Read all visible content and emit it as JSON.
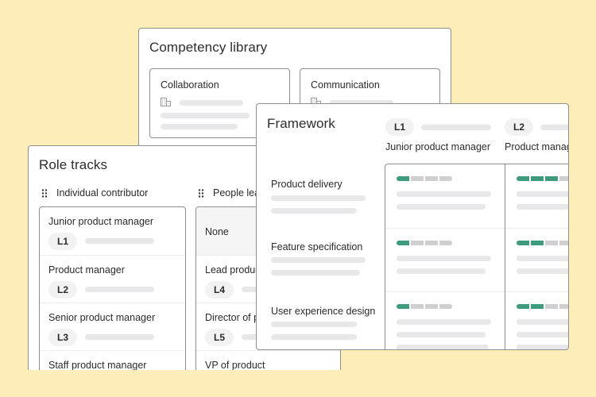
{
  "colors": {
    "background": "#fdedb8",
    "accent_green": "#3e9b7d",
    "rating_off": "#cfcfd1",
    "border": "#8f8f8f"
  },
  "competency_library": {
    "title": "Competency library",
    "cards": [
      {
        "label": "Collaboration",
        "icon": "building-icon"
      },
      {
        "label": "Communication",
        "icon": "building-icon"
      }
    ]
  },
  "role_tracks": {
    "title": "Role tracks",
    "columns": [
      {
        "heading": "Individual contributor",
        "icon": "drag-handle-icon",
        "items": [
          {
            "title": "Junior product manager",
            "level": "L1"
          },
          {
            "title": "Product manager",
            "level": "L2"
          },
          {
            "title": "Senior product manager",
            "level": "L3"
          },
          {
            "title": "Staff product manager",
            "level": ""
          }
        ]
      },
      {
        "heading": "People leader",
        "icon": "drag-handle-icon",
        "items": [
          {
            "title": "None",
            "level": ""
          },
          {
            "title": "Lead product manager",
            "level": "L4"
          },
          {
            "title": "Director of product",
            "level": "L5"
          },
          {
            "title": "VP of product",
            "level": ""
          }
        ]
      }
    ]
  },
  "framework": {
    "title": "Framework",
    "levels": [
      {
        "level": "L1",
        "role": "Junior product manager"
      },
      {
        "level": "L2",
        "role": "Product manager"
      }
    ],
    "competencies": [
      {
        "name": "Product delivery",
        "ratings": [
          1,
          3
        ]
      },
      {
        "name": "Feature specification",
        "ratings": [
          1,
          2
        ]
      },
      {
        "name": "User experience design",
        "ratings": [
          1,
          2
        ]
      }
    ],
    "rating_max": 4
  }
}
